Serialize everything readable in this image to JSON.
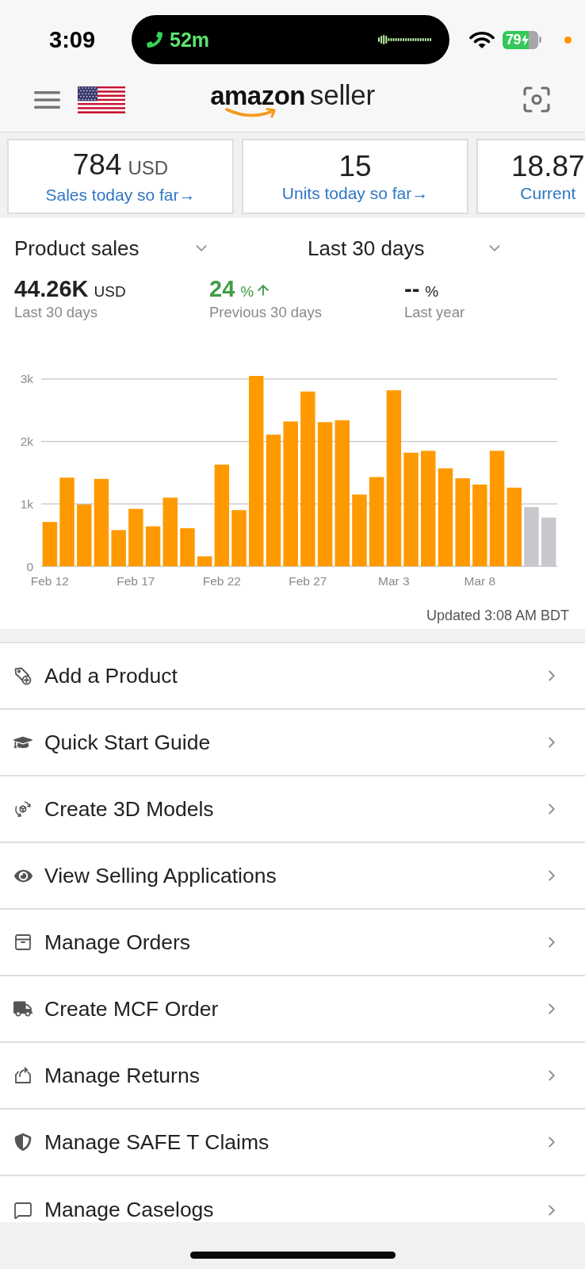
{
  "status_bar": {
    "time": "3:09",
    "call_duration": "52m",
    "battery": "79"
  },
  "header": {
    "logo": {
      "brand": "amazon",
      "suffix": "seller"
    }
  },
  "stat_cards": [
    {
      "value": "784",
      "unit": "USD",
      "link": "Sales today so far→"
    },
    {
      "value": "15",
      "link": "Units today so far→"
    },
    {
      "value": "18.87",
      "link": "Current"
    }
  ],
  "sales_panel": {
    "metric_dropdown": "Product sales",
    "period_dropdown": "Last 30 days",
    "metrics": [
      {
        "value": "44.26K",
        "unit": "USD",
        "caption": "Last 30 days",
        "rising": false
      },
      {
        "value": "24",
        "unit": "%",
        "caption": "Previous 30 days",
        "rising": true
      },
      {
        "value": "--",
        "unit": "%",
        "caption": "Last year",
        "rising": false
      }
    ],
    "chart_data": {
      "type": "bar",
      "categories": [
        "Feb 12",
        null,
        null,
        null,
        null,
        "Feb 17",
        null,
        null,
        null,
        null,
        "Feb 22",
        null,
        null,
        null,
        null,
        "Feb 27",
        null,
        null,
        null,
        null,
        "Mar 3",
        null,
        null,
        null,
        null,
        "Mar 8",
        null,
        null,
        null,
        null
      ],
      "series": [
        {
          "color": "#ff9900",
          "values": [
            710,
            1420,
            990,
            1400,
            580,
            920,
            640,
            1100,
            610,
            160,
            1630,
            900,
            3050,
            2110,
            2320,
            2800,
            2310,
            2340,
            1150,
            1430,
            2820,
            1820,
            1850,
            1570,
            1410,
            1310,
            1850,
            1260,
            null,
            null
          ]
        },
        {
          "color": "#c7c7cc",
          "values": [
            null,
            null,
            null,
            null,
            null,
            null,
            null,
            null,
            null,
            null,
            null,
            null,
            null,
            null,
            null,
            null,
            null,
            null,
            null,
            null,
            null,
            null,
            null,
            null,
            null,
            null,
            null,
            null,
            950,
            780
          ]
        }
      ],
      "ylim": [
        0,
        3050
      ],
      "yticks": [
        {
          "value": 0,
          "label": "0"
        },
        {
          "value": 1000,
          "label": "1k"
        },
        {
          "value": 2000,
          "label": "2k"
        },
        {
          "value": 3000,
          "label": "3k"
        }
      ],
      "grid": true
    },
    "updated": "Updated 3:08 AM BDT"
  },
  "menu": [
    {
      "label": "Add a Product"
    },
    {
      "label": "Quick Start Guide"
    },
    {
      "label": "Create 3D Models"
    },
    {
      "label": "View Selling Applications"
    },
    {
      "label": "Manage Orders"
    },
    {
      "label": "Create MCF Order"
    },
    {
      "label": "Manage Returns"
    },
    {
      "label": "Manage SAFE T Claims"
    },
    {
      "label": "Manage Caselogs"
    }
  ]
}
